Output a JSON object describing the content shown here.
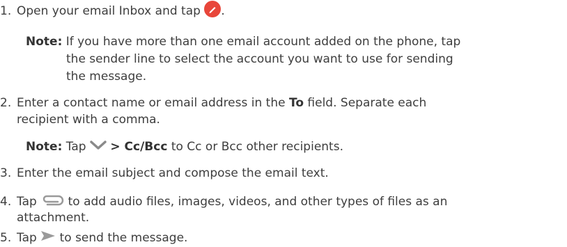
{
  "steps": {
    "s1": {
      "num": "1.",
      "pre": "Open your email Inbox and tap",
      "post": "."
    },
    "note1": {
      "label": "Note:",
      "line1": "If you have more than one email account added on the phone, tap",
      "line2": "the sender line to select the account you want to use for sending",
      "line3": "the message."
    },
    "s2": {
      "num": "2.",
      "pre": "Enter a contact name or email address in the",
      "bold": "To",
      "post": "field. Separate each",
      "line2": "recipient with a comma."
    },
    "note2": {
      "label": "Note:",
      "pre": "Tap",
      "bold": "> Cc/Bcc",
      "post": "to Cc or Bcc other recipients."
    },
    "s3": {
      "num": "3.",
      "text": "Enter the email subject and compose the email text."
    },
    "s4": {
      "num": "4.",
      "pre": "Tap",
      "post": "to add audio files, images, videos, and other types of files as an",
      "line2": "attachment."
    },
    "s5": {
      "num": "5.",
      "pre": "Tap",
      "post": "to send the message."
    }
  },
  "icons": {
    "compose": "compose-icon",
    "chevron": "chevron-down-icon",
    "attach": "paperclip-icon",
    "send": "send-icon"
  },
  "colors": {
    "compose": "#e8463a",
    "icon_gray": "#9a9a9a",
    "text": "#3e3e3e"
  }
}
